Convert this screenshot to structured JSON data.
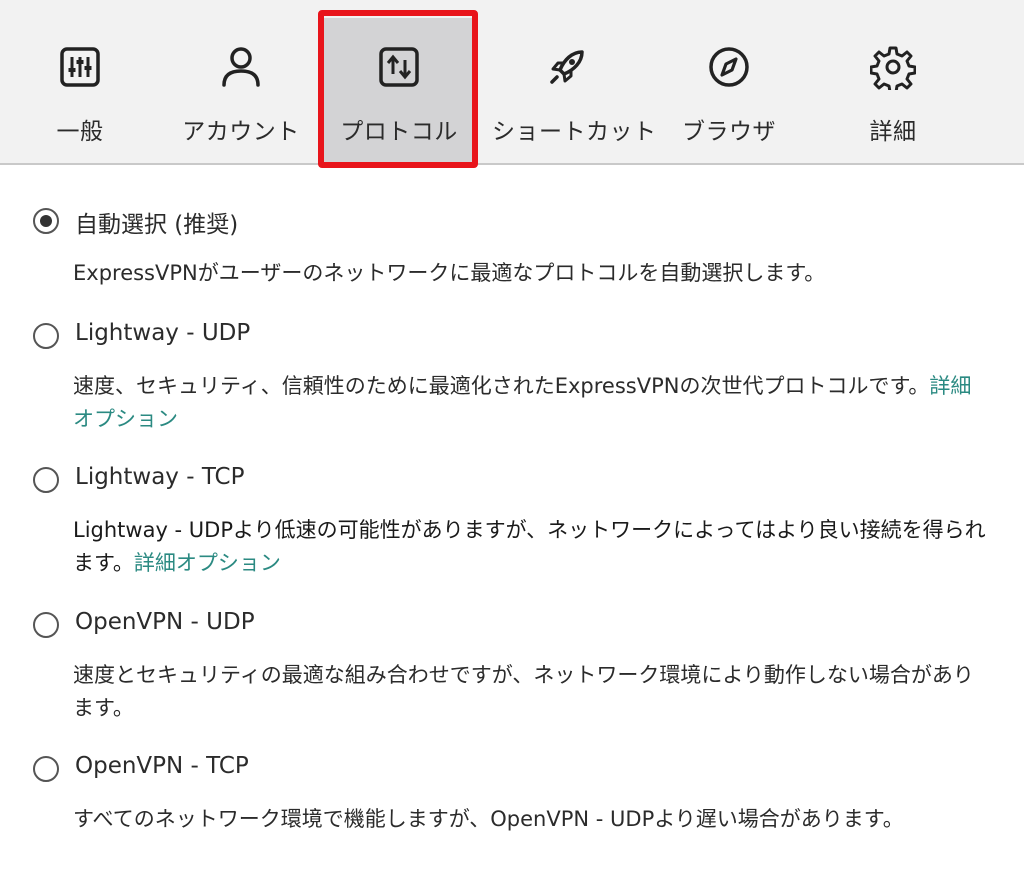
{
  "tabs": [
    {
      "label": "一般",
      "icon": "sliders-icon"
    },
    {
      "label": "アカウント",
      "icon": "user-icon"
    },
    {
      "label": "プロトコル",
      "icon": "protocol-icon",
      "active": true
    },
    {
      "label": "ショートカット",
      "icon": "rocket-icon"
    },
    {
      "label": "ブラウザ",
      "icon": "compass-icon"
    },
    {
      "label": "詳細",
      "icon": "gear-icon"
    }
  ],
  "options": [
    {
      "title": "自動選択 (推奨)",
      "desc": "ExpressVPNがユーザーのネットワークに最適なプロトコルを自動選択します。",
      "checked": true
    },
    {
      "title": "Lightway - UDP",
      "desc": "速度、セキュリティ、信頼性のために最適化されたExpressVPNの次世代プロトコルです。",
      "link": "詳細オプション",
      "checked": false
    },
    {
      "title": "Lightway - TCP",
      "desc": "Lightway - UDPより低速の可能性がありますが、ネットワークによってはより良い接続を得られます。",
      "link": "詳細オプション",
      "checked": false
    },
    {
      "title": "OpenVPN - UDP",
      "desc": "速度とセキュリティの最適な組み合わせですが、ネットワーク環境により動作しない場合があります。",
      "checked": false
    },
    {
      "title": "OpenVPN - TCP",
      "desc": "すべてのネットワーク環境で機能しますが、OpenVPN - UDPより遅い場合があります。",
      "checked": false
    }
  ],
  "colors": {
    "link": "#2b8a82",
    "highlight": "#e8141b",
    "active_tab_bg": "#d3d3d5"
  }
}
